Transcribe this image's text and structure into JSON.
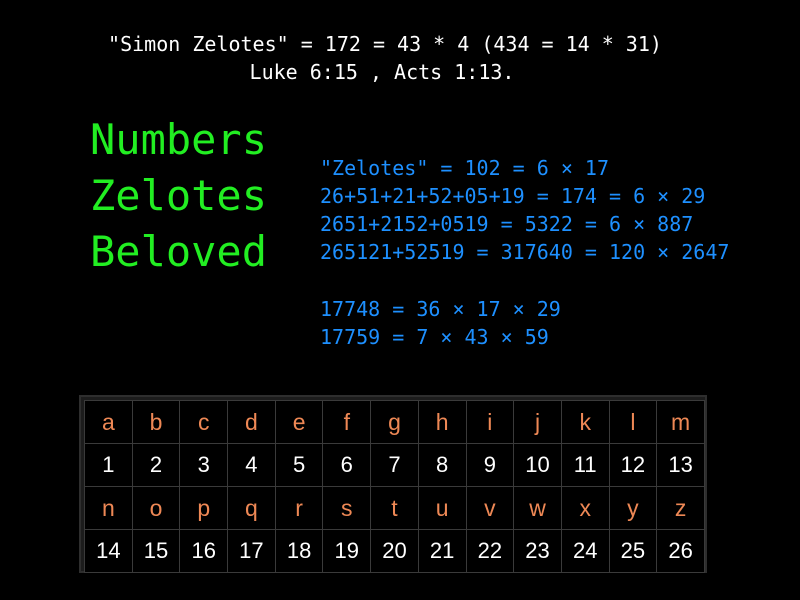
{
  "heading": {
    "line1": "\"Simon Zelotes\" = 172 = 43 * 4 (434 = 14 * 31)",
    "line2": "Luke 6:15 , Acts 1:13."
  },
  "big_words": [
    "Numbers",
    "Zelotes",
    "Beloved"
  ],
  "equations": [
    "\"Zelotes\" = 102 = 6 × 17",
    "26+51+21+52+05+19 = 174 = 6 × 29",
    "2651+2152+0519 = 5322 = 6 × 887",
    "265121+52519 = 317640 = 120 × 2647"
  ],
  "factorizations": [
    "17748 = 36 × 17 × 29",
    "17759 = 7 × 43 × 59"
  ],
  "alphabet_table": {
    "rows": [
      {
        "kind": "letter",
        "cells": [
          "a",
          "b",
          "c",
          "d",
          "e",
          "f",
          "g",
          "h",
          "i",
          "j",
          "k",
          "l",
          "m"
        ]
      },
      {
        "kind": "number",
        "cells": [
          "1",
          "2",
          "3",
          "4",
          "5",
          "6",
          "7",
          "8",
          "9",
          "10",
          "11",
          "12",
          "13"
        ]
      },
      {
        "kind": "letter",
        "cells": [
          "n",
          "o",
          "p",
          "q",
          "r",
          "s",
          "t",
          "u",
          "v",
          "w",
          "x",
          "y",
          "z"
        ]
      },
      {
        "kind": "number",
        "cells": [
          "14",
          "15",
          "16",
          "17",
          "18",
          "19",
          "20",
          "21",
          "22",
          "23",
          "24",
          "25",
          "26"
        ]
      }
    ]
  },
  "colors": {
    "background": "#000000",
    "heading_text": "#ffffff",
    "big_words": "#22ee22",
    "equations": "#1e90ff",
    "table_letters": "#ee8855",
    "table_numbers": "#ffffff"
  }
}
